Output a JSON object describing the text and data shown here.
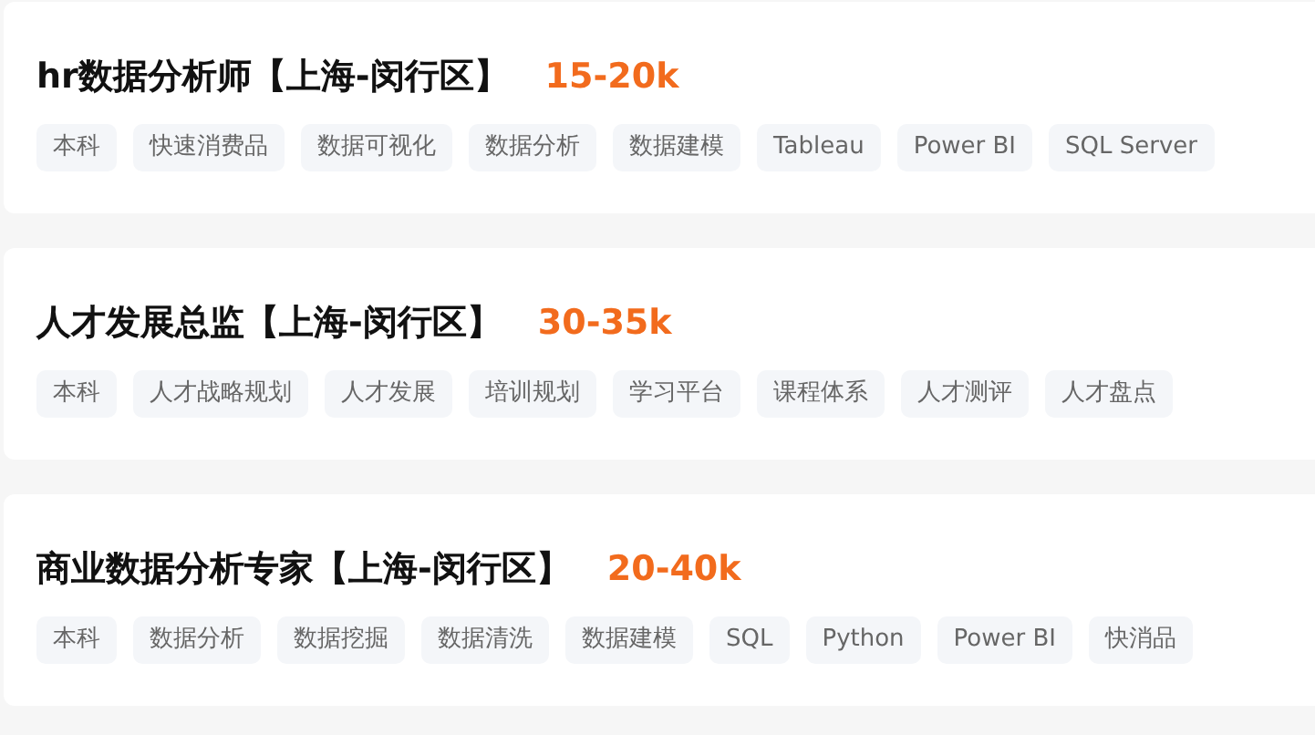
{
  "jobs": [
    {
      "title": "hr数据分析师【上海-闵行区】",
      "salary": "15-20k",
      "tags": [
        "本科",
        "快速消费品",
        "数据可视化",
        "数据分析",
        "数据建模",
        "Tableau",
        "Power BI",
        "SQL Server"
      ]
    },
    {
      "title": "人才发展总监【上海-闵行区】",
      "salary": "30-35k",
      "tags": [
        "本科",
        "人才战略规划",
        "人才发展",
        "培训规划",
        "学习平台",
        "课程体系",
        "人才测评",
        "人才盘点"
      ]
    },
    {
      "title": "商业数据分析专家【上海-闵行区】",
      "salary": "20-40k",
      "tags": [
        "本科",
        "数据分析",
        "数据挖掘",
        "数据清洗",
        "数据建模",
        "SQL",
        "Python",
        "Power BI",
        "快消品"
      ]
    }
  ]
}
